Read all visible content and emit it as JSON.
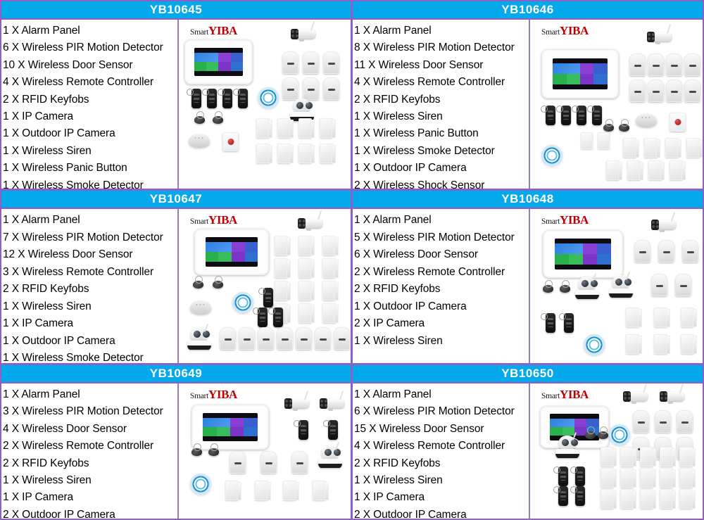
{
  "brand": {
    "prefix": "Smart",
    "name": "YIBA"
  },
  "colors": {
    "header_bg": "#04a9ec",
    "header_text": "#ffffff",
    "cell_border": "#8f5fc4",
    "brand_red": "#c00000",
    "text": "#000000"
  },
  "products": [
    {
      "model": "YB10645",
      "items": [
        "1 X Alarm Panel",
        "6 X Wireless PIR Motion Detector",
        "10 X Wireless Door Sensor",
        "4 X Wireless Remote Controller",
        "2 X RFID Keyfobs",
        "1 X IP Camera",
        "1 X Outdoor IP Camera",
        "1 X Wireless Siren",
        "1 X Wireless Panic Button",
        "1 X Wireless Smoke Detector"
      ]
    },
    {
      "model": "YB10646",
      "items": [
        "1 X Alarm Panel",
        "8 X Wireless PIR Motion Detector",
        "11 X Wireless Door Sensor",
        "4 X Wireless Remote Controller",
        "2 X RFID Keyfobs",
        "1 X Wireless Siren",
        "1 X Wireless Panic Button",
        "1 X Wireless Smoke Detector",
        "1 X Outdoor IP Camera",
        "2 X Wireless Shock Sensor"
      ]
    },
    {
      "model": "YB10647",
      "items": [
        "1 X Alarm Panel",
        "7 X Wireless PIR Motion Detector",
        "12 X Wireless Door Sensor",
        "3 X Wireless Remote Controller",
        "2 X RFID Keyfobs",
        "1 X Wireless Siren",
        "1 X IP Camera",
        "1 X Outdoor IP Camera",
        "1 X Wireless Smoke Detector"
      ]
    },
    {
      "model": "YB10648",
      "items": [
        "1 X Alarm Panel",
        "5 X Wireless PIR Motion Detector",
        "6 X Wireless Door Sensor",
        "2 X Wireless Remote Controller",
        "2 X RFID Keyfobs",
        "1 X Outdoor IP Camera",
        "2 X IP Camera",
        "1 X Wireless Siren"
      ]
    },
    {
      "model": "YB10649",
      "items": [
        "1 X Alarm Panel",
        "3 X Wireless PIR Motion Detector",
        "4 X Wireless Door Sensor",
        "2 X Wireless Remote Controller",
        "2 X RFID Keyfobs",
        "1 X Wireless Siren",
        "1 X IP Camera",
        "2 X Outdoor IP Camera"
      ]
    },
    {
      "model": "YB10650",
      "items": [
        "1 X Alarm Panel",
        "6 X Wireless PIR Motion Detector",
        "15 X Wireless Door Sensor",
        "4 X Wireless Remote Controller",
        "2 X RFID Keyfobs",
        "1 X Wireless Siren",
        "1 X IP Camera",
        "2 X Outdoor IP Camera"
      ]
    }
  ]
}
